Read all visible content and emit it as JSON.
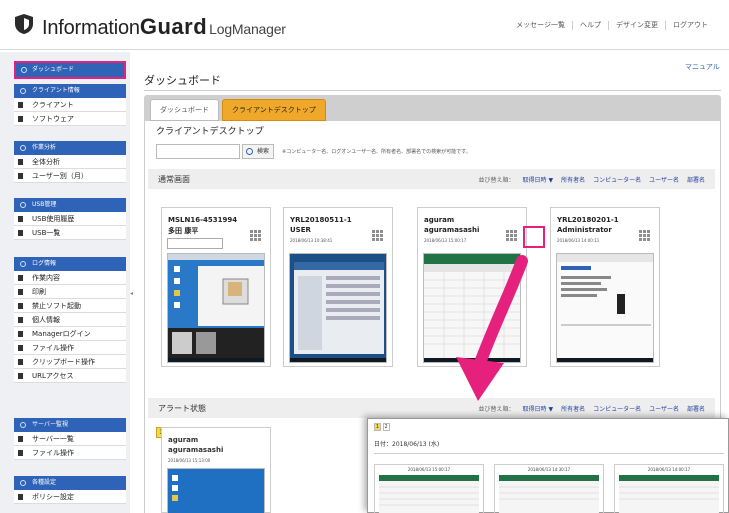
{
  "header": {
    "brand_information": "Information",
    "brand_guard": "Guard",
    "brand_logmanager": "LogManager",
    "links": [
      "メッセージ一覧",
      "ヘルプ",
      "デザイン変更",
      "ログアウト"
    ]
  },
  "sidebar": {
    "dashboard": "ダッシュボード",
    "sections": [
      {
        "title": "クライアント情報",
        "items": [
          "クライアント",
          "ソフトウェア"
        ]
      },
      {
        "title": "作業分析",
        "items": [
          "全体分析",
          "ユーザー別（月）"
        ]
      },
      {
        "title": "USB管理",
        "items": [
          "USB使用履歴",
          "USB一覧"
        ]
      },
      {
        "title": "ログ情報",
        "items": [
          "作業内容",
          "印刷",
          "禁止ソフト起動",
          "個人情報",
          "Managerログイン",
          "ファイル操作",
          "クリップボード操作",
          "URLアクセス"
        ]
      },
      {
        "title": "サーバー監視",
        "items": [
          "サーバー一覧",
          "ファイル操作"
        ]
      },
      {
        "title": "各種設定",
        "items": [
          "ポリシー設定"
        ]
      }
    ]
  },
  "main": {
    "title": "ダッシュボード",
    "manual": "マニュアル",
    "tabs": [
      "ダッシュボード",
      "クライアントデスクトップ"
    ],
    "section_title": "クライアントデスクトップ",
    "search_button": "検索",
    "search_note": "※コンピューター名、ログオンユーザー名、所有者名、部署名での検索が可能です。",
    "normal_label": "通常画面",
    "alert_label": "アラート状態",
    "sort_label": "並び替え順：",
    "sort_items": [
      "取得日時 ▼",
      "所有者名",
      "コンピューター名",
      "ユーザー名",
      "部署名"
    ],
    "page_number": "1",
    "cards": [
      {
        "line1": "MSLN16-4531994",
        "line2": "多田 康平",
        "date": ""
      },
      {
        "line1": "YRL20180511-1",
        "line2": "USER",
        "date": "2018/06/13 10:38:41"
      },
      {
        "line1": "aguram",
        "line2": "aguramasashi",
        "date": "2018/06/13 15:00:17"
      },
      {
        "line1": "YRL20180201-1",
        "line2": "Administrator",
        "date": "2018/06/13 14:00:11"
      }
    ],
    "alert_card": {
      "line1": "aguram",
      "line2": "aguramasashi",
      "date": "2018/06/13 15:13:00"
    }
  },
  "popup": {
    "pages": [
      "1",
      "2"
    ],
    "date_label": "日付：2018/06/13 (水)",
    "shots": [
      "2018/06/13 15:00:17",
      "2018/06/13 14:30:17",
      "2018/06/13 14:00:17"
    ]
  }
}
